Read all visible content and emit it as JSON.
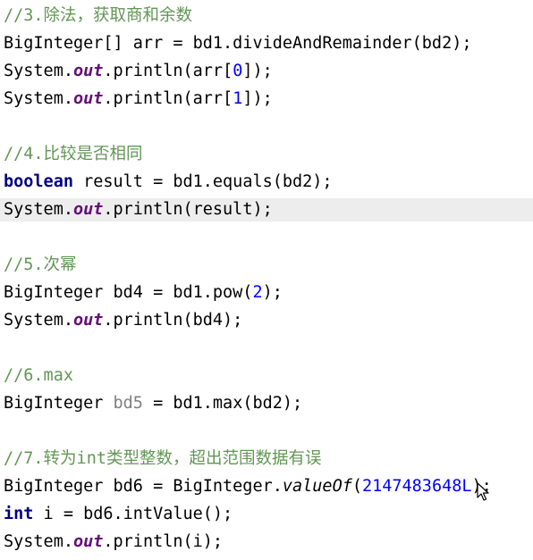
{
  "editor": {
    "lines": [
      {
        "tokens": [
          {
            "t": "//3.除法，获取商和余数",
            "c": "comment"
          }
        ]
      },
      {
        "tokens": [
          {
            "t": "BigInteger[] arr = bd1.divideAndRemainder(bd2);",
            "c": "plain"
          }
        ]
      },
      {
        "tokens": [
          {
            "t": "System.",
            "c": "plain"
          },
          {
            "t": "out",
            "c": "field"
          },
          {
            "t": ".println(arr[",
            "c": "plain"
          },
          {
            "t": "0",
            "c": "number"
          },
          {
            "t": "]);",
            "c": "plain"
          }
        ]
      },
      {
        "tokens": [
          {
            "t": "System.",
            "c": "plain"
          },
          {
            "t": "out",
            "c": "field"
          },
          {
            "t": ".println(arr[",
            "c": "plain"
          },
          {
            "t": "1",
            "c": "number"
          },
          {
            "t": "]);",
            "c": "plain"
          }
        ]
      },
      {
        "tokens": []
      },
      {
        "tokens": [
          {
            "t": "//4.比较是否相同",
            "c": "comment"
          }
        ]
      },
      {
        "tokens": [
          {
            "t": "boolean",
            "c": "keyword"
          },
          {
            "t": " result = bd1.equals(bd2);",
            "c": "plain"
          }
        ]
      },
      {
        "selected": true,
        "tokens": [
          {
            "t": "System.",
            "c": "plain"
          },
          {
            "t": "out",
            "c": "field"
          },
          {
            "t": ".println(result);",
            "c": "plain"
          }
        ]
      },
      {
        "tokens": []
      },
      {
        "tokens": [
          {
            "t": "//5.次幂",
            "c": "comment"
          }
        ]
      },
      {
        "tokens": [
          {
            "t": "BigInteger bd4 = bd1.pow(",
            "c": "plain"
          },
          {
            "t": "2",
            "c": "number"
          },
          {
            "t": ");",
            "c": "plain"
          }
        ]
      },
      {
        "tokens": [
          {
            "t": "System.",
            "c": "plain"
          },
          {
            "t": "out",
            "c": "field"
          },
          {
            "t": ".println(bd4);",
            "c": "plain"
          }
        ]
      },
      {
        "tokens": []
      },
      {
        "tokens": [
          {
            "t": "//6.max",
            "c": "comment"
          }
        ]
      },
      {
        "tokens": [
          {
            "t": "BigInteger ",
            "c": "plain"
          },
          {
            "t": "bd5",
            "c": "unused"
          },
          {
            "t": " = bd1.max(bd2);",
            "c": "plain"
          }
        ]
      },
      {
        "tokens": []
      },
      {
        "tokens": [
          {
            "t": "//7.转为int类型整数，超出范围数据有误",
            "c": "comment"
          }
        ]
      },
      {
        "tokens": [
          {
            "t": "BigInteger bd6 = BigInteger.",
            "c": "plain"
          },
          {
            "t": "valueOf",
            "c": "static-method"
          },
          {
            "t": "(",
            "c": "plain"
          },
          {
            "t": "2147483648L",
            "c": "number"
          },
          {
            "t": ");",
            "c": "plain"
          }
        ]
      },
      {
        "tokens": [
          {
            "t": "int",
            "c": "keyword"
          },
          {
            "t": " i = bd6.intValue();",
            "c": "plain"
          }
        ]
      },
      {
        "tokens": [
          {
            "t": "System.",
            "c": "plain"
          },
          {
            "t": "out",
            "c": "field"
          },
          {
            "t": ".println(i);",
            "c": "plain"
          }
        ]
      }
    ]
  },
  "cursor": {
    "icon": "mouse-pointer-icon"
  },
  "colors": {
    "comment": "#629755",
    "keyword": "#000080",
    "field": "#660e7a",
    "number": "#0000ff",
    "unused": "#808080",
    "selected_line": "#ededed"
  }
}
